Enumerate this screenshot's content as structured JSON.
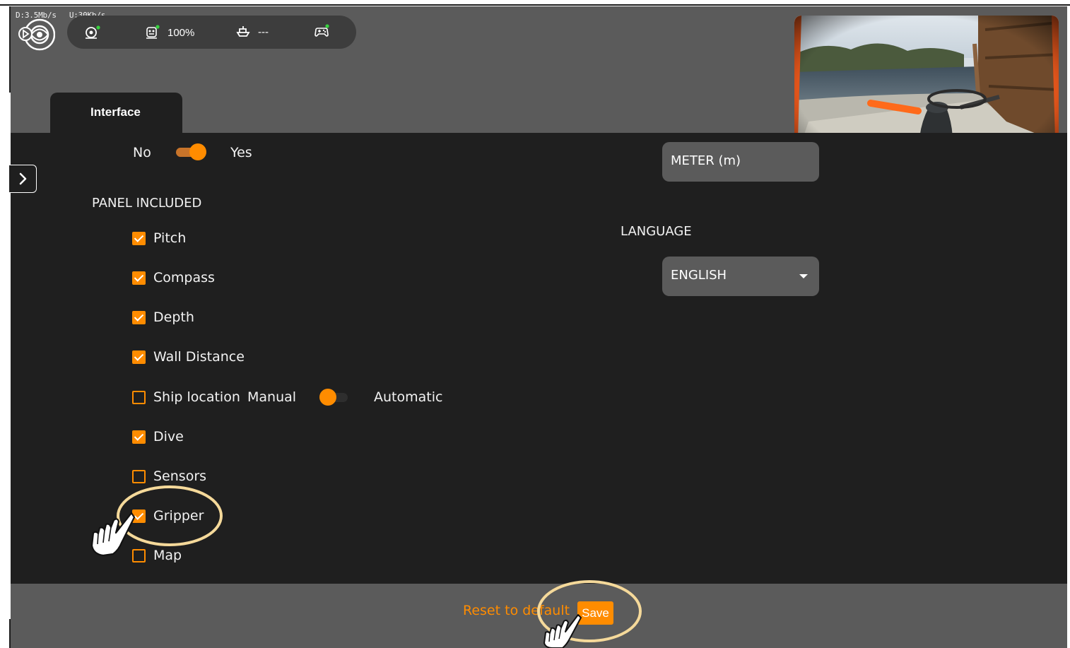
{
  "network": {
    "download": "D:3.5Mb/s",
    "upload": "U:30Kb/s"
  },
  "status_bar": {
    "items": [
      {
        "icon": "rov-icon",
        "value": ""
      },
      {
        "icon": "battery-robot-icon",
        "value": "100%"
      },
      {
        "icon": "boat-icon",
        "value": "---"
      },
      {
        "icon": "gamepad-icon",
        "value": ""
      }
    ],
    "indicator_color": "#37d13f"
  },
  "tabs": [
    {
      "label": "Interface",
      "active": true
    }
  ],
  "top_toggle": {
    "off_label": "No",
    "on_label": "Yes",
    "value": "Yes"
  },
  "panel_included": {
    "title": "PANEL INCLUDED",
    "items": [
      {
        "label": "Pitch",
        "checked": true
      },
      {
        "label": "Compass",
        "checked": true
      },
      {
        "label": "Depth",
        "checked": true
      },
      {
        "label": "Wall Distance",
        "checked": true
      },
      {
        "label": "Ship location",
        "checked": false
      },
      {
        "label": "Dive",
        "checked": true
      },
      {
        "label": "Sensors",
        "checked": false
      },
      {
        "label": "Gripper",
        "checked": true
      },
      {
        "label": "Map",
        "checked": false
      }
    ]
  },
  "ship_location_mode": {
    "off_label": "Manual",
    "on_label": "Automatic",
    "value": "Manual"
  },
  "units": {
    "selected": "METER (m)"
  },
  "language": {
    "title": "LANGUAGE",
    "selected": "ENGLISH"
  },
  "footer": {
    "reset_label": "Reset to default",
    "save_label": "Save"
  },
  "colors": {
    "accent": "#ff8c00",
    "panel_bg": "#1f1f1f",
    "header_bg": "#5b5b5b",
    "highlight_ring": "#f5d99a"
  }
}
